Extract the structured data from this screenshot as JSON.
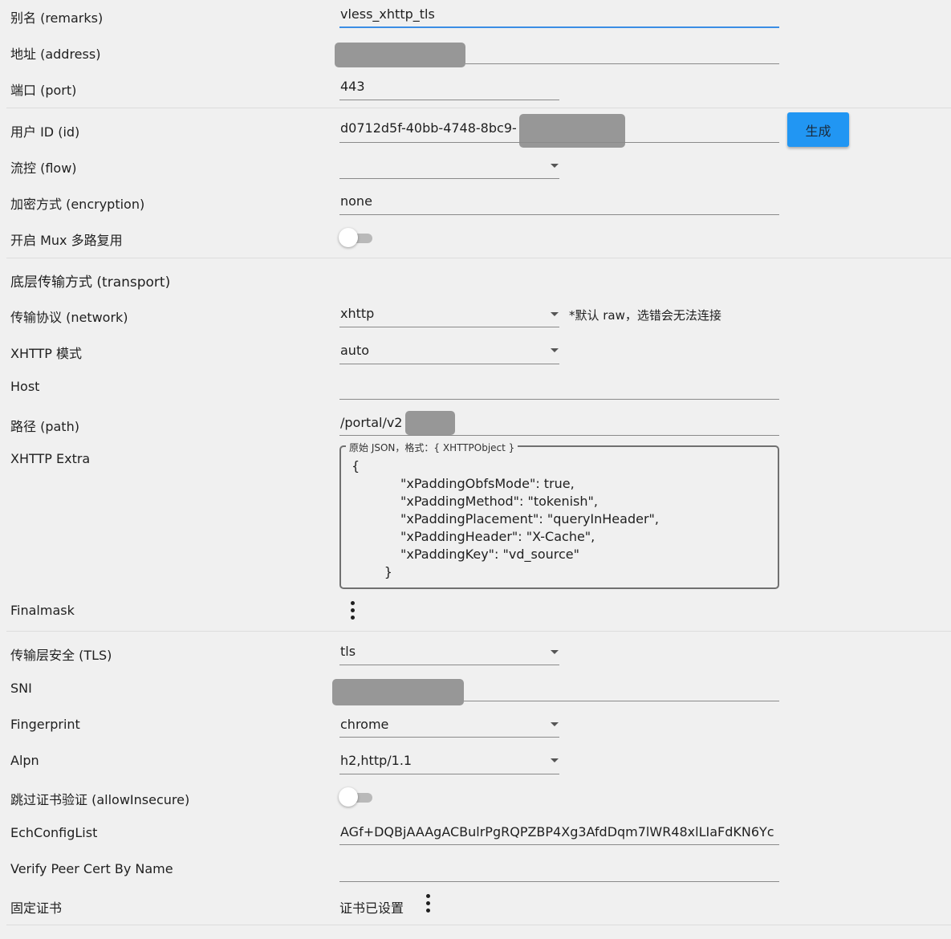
{
  "fields": {
    "remarks": {
      "label": "别名 (remarks)",
      "value": "vless_xhttp_tls"
    },
    "address": {
      "label": "地址 (address)",
      "value": ""
    },
    "port": {
      "label": "端口 (port)",
      "value": "443"
    },
    "id": {
      "label": "用户 ID (id)",
      "value": "d0712d5f-40bb-4748-8bc9-",
      "generate_label": "生成"
    },
    "flow": {
      "label": "流控 (flow)",
      "value": ""
    },
    "encryption": {
      "label": "加密方式 (encryption)",
      "value": "none"
    },
    "mux": {
      "label": "开启 Mux 多路复用",
      "enabled": false
    }
  },
  "transport": {
    "section_label": "底层传输方式 (transport)",
    "network": {
      "label": "传输协议 (network)",
      "value": "xhttp",
      "hint": "*默认 raw，选错会无法连接"
    },
    "xhttp_mode": {
      "label": "XHTTP 模式",
      "value": "auto"
    },
    "host": {
      "label": "Host",
      "value": ""
    },
    "path": {
      "label": "路径 (path)",
      "value": "/portal/v2"
    },
    "xhttp_extra": {
      "label": "XHTTP Extra",
      "legend": "原始 JSON，格式：{ XHTTPObject }",
      "value": "{\n            \"xPaddingObfsMode\": true,\n            \"xPaddingMethod\": \"tokenish\",\n            \"xPaddingPlacement\": \"queryInHeader\",\n            \"xPaddingHeader\": \"X-Cache\",\n            \"xPaddingKey\": \"vd_source\"\n        }"
    },
    "finalmask": {
      "label": "Finalmask"
    }
  },
  "tls": {
    "security": {
      "label": "传输层安全 (TLS)",
      "value": "tls"
    },
    "sni": {
      "label": "SNI",
      "value": ""
    },
    "fingerprint": {
      "label": "Fingerprint",
      "value": "chrome"
    },
    "alpn": {
      "label": "Alpn",
      "value": "h2,http/1.1"
    },
    "allow_insecure": {
      "label": "跳过证书验证 (allowInsecure)",
      "enabled": false
    },
    "ech_config_list": {
      "label": "EchConfigList",
      "value": "AGf+DQBjAAAgACBulrPgRQPZBP4Xg3AfdDqm7lWR48xlLIaFdKN6Yc"
    },
    "verify_peer_cert_by_name": {
      "label": "Verify Peer Cert By Name",
      "value": ""
    },
    "pinned_cert": {
      "label": "固定证书",
      "status": "证书已设置"
    }
  }
}
